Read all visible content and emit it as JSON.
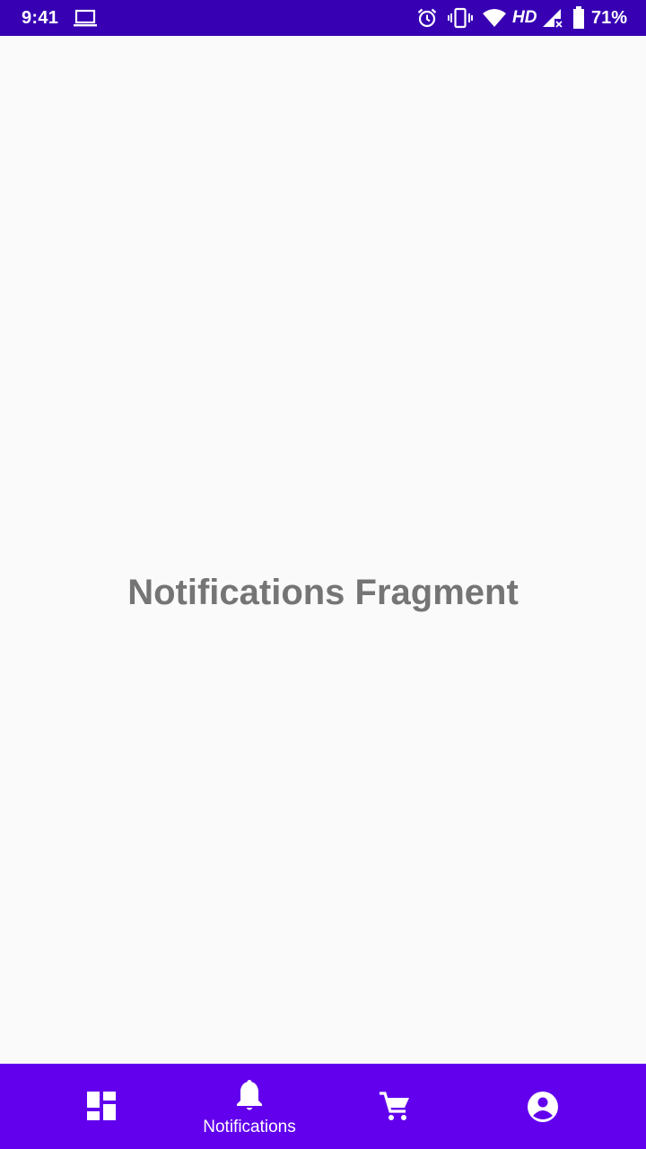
{
  "status_bar": {
    "time": "9:41",
    "network_type": "HD",
    "battery_level": "71%",
    "icons": [
      "laptop-icon",
      "alarm-icon",
      "vibrate-icon",
      "wifi-icon",
      "signal-icon",
      "battery-icon"
    ],
    "background_color": "#3700b3"
  },
  "content": {
    "fragment_text": "Notifications Fragment",
    "text_color": "#757575",
    "background_color": "#fafafa"
  },
  "bottom_nav": {
    "background_color": "#6200ee",
    "items": [
      {
        "id": "dashboard",
        "icon": "dashboard-icon",
        "label": "",
        "selected": false
      },
      {
        "id": "notifications",
        "icon": "bell-icon",
        "label": "Notifications",
        "selected": true
      },
      {
        "id": "cart",
        "icon": "cart-icon",
        "label": "",
        "selected": false
      },
      {
        "id": "account",
        "icon": "account-circle-icon",
        "label": "",
        "selected": false
      }
    ]
  }
}
